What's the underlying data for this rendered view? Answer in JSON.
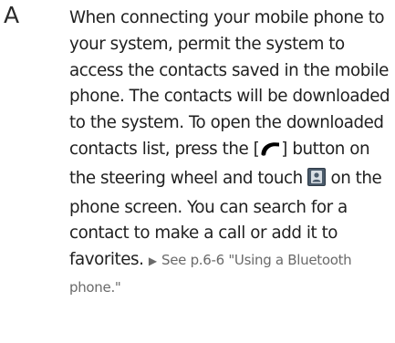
{
  "answer": {
    "letter": "A",
    "text_1": "When connecting your mobile phone to your system, permit the system to access the contacts saved in the mobile phone. The contacts will be downloaded to the system. To open the downloaded contacts list, press the [",
    "text_2": "] button on the steering wheel and touch",
    "text_3": "on the phone screen. You can search for a contact to make a call or add it to favorites.",
    "ref_arrow": "▶",
    "ref_text": "See p.6-6 \"Using a Bluetooth phone.\""
  },
  "icons": {
    "call_button": "phone-handset-icon",
    "contacts": "contacts-list-icon"
  },
  "colors": {
    "text": "#1f1f1f",
    "reference": "#6a6a6a",
    "contacts_icon_bg": "#4a5a6a"
  }
}
